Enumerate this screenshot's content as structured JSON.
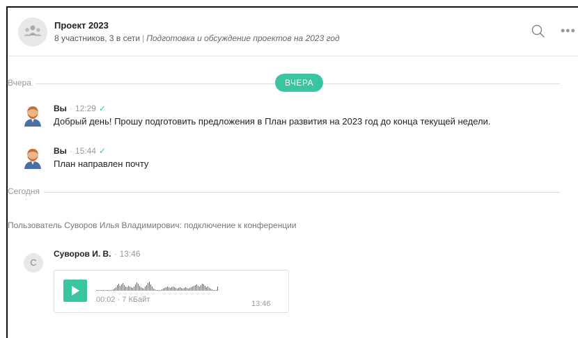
{
  "header": {
    "title": "Проект 2023",
    "participants": "8 участников, 3 в сети",
    "separator": "|",
    "description": "Подготовка и обсуждение проектов на 2023 год"
  },
  "dividers": {
    "yesterday_label": "Вчера",
    "yesterday_pill": "ВЧЕРА",
    "today_label": "Сегодня"
  },
  "messages": [
    {
      "author": "Вы",
      "time": "12:29",
      "status": "✓",
      "text": "Добрый день! Прошу подготовить предложения в План развития на 2023 год до конца текущей недели."
    },
    {
      "author": "Вы",
      "time": "15:44",
      "status": "✓",
      "text": "План направлен почту"
    }
  ],
  "system_message": "Пользователь Суворов Илья Владимирович: подключение к конференции",
  "voice_message": {
    "avatar_letter": "С",
    "author": "Суворов И. В.",
    "time": "13:46",
    "duration_size": "00:02 · 7 КБайт",
    "audio_time": "13:46"
  },
  "colors": {
    "accent": "#39c4a2",
    "muted_text": "#999999",
    "divider": "#dedede"
  },
  "icons": [
    "group-icon",
    "search-icon",
    "more-icon",
    "user-avatar-icon",
    "play-icon"
  ]
}
